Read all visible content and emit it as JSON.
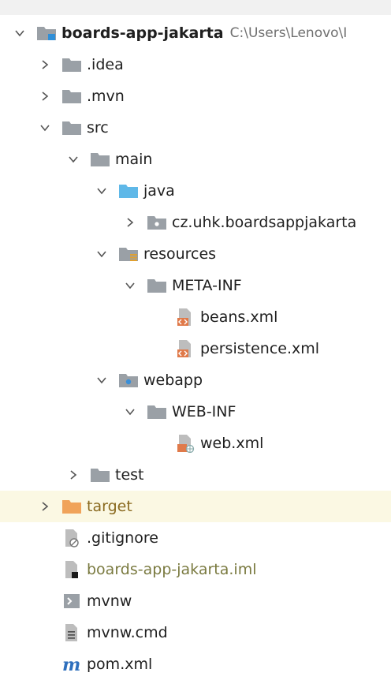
{
  "tree": {
    "root": {
      "label": "boards-app-jakarta",
      "path": "C:\\Users\\Lenovo\\I"
    },
    "items": [
      {
        "label": ".idea"
      },
      {
        "label": ".mvn"
      },
      {
        "label": "src"
      },
      {
        "label": "main"
      },
      {
        "label": "java"
      },
      {
        "label": "cz.uhk.boardsappjakarta"
      },
      {
        "label": "resources"
      },
      {
        "label": "META-INF"
      },
      {
        "label": "beans.xml"
      },
      {
        "label": "persistence.xml"
      },
      {
        "label": "webapp"
      },
      {
        "label": "WEB-INF"
      },
      {
        "label": "web.xml"
      },
      {
        "label": "test"
      },
      {
        "label": "target"
      },
      {
        "label": ".gitignore"
      },
      {
        "label": "boards-app-jakarta.iml"
      },
      {
        "label": "mvnw"
      },
      {
        "label": "mvnw.cmd"
      },
      {
        "label": "pom.xml"
      }
    ]
  },
  "colors": {
    "folder": "#9aa0a6",
    "source_folder": "#5fb8e8",
    "excluded_folder": "#f0a35a",
    "xml_file": "#e07a4a",
    "maven": "#2e6fbd",
    "highlight": "#fbf8e3"
  }
}
